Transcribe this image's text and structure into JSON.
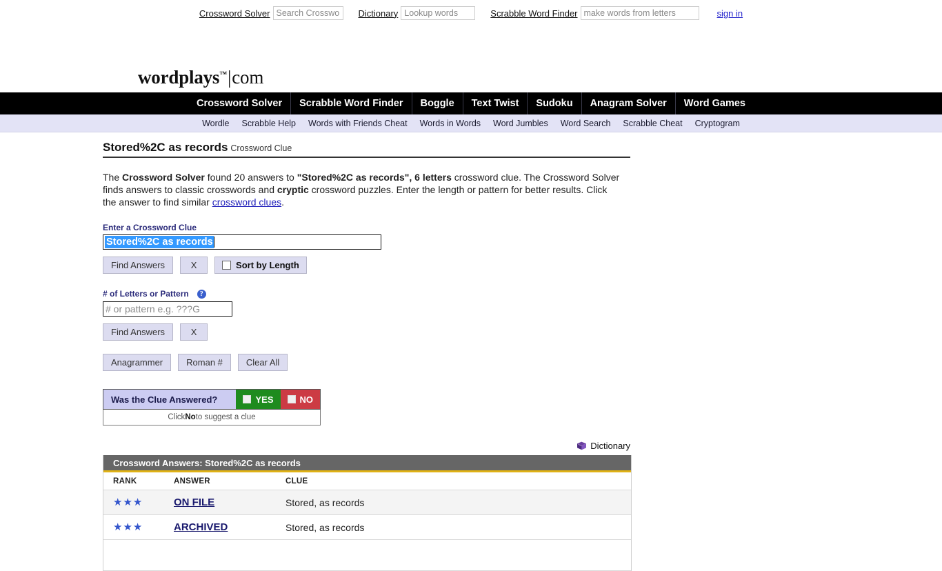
{
  "topbar": {
    "crossword_solver_link": "Crossword Solver",
    "crossword_search_placeholder": "Search Crosswords",
    "dictionary_link": "Dictionary",
    "dictionary_search_placeholder": "Lookup words",
    "scrabble_link": "Scrabble Word Finder",
    "scrabble_search_placeholder": "make words from letters",
    "signin_label": "sign in"
  },
  "logo": {
    "name": "wordplays",
    "tm": "™",
    "separator": "|",
    "domain": "com"
  },
  "mainnav": {
    "items": [
      {
        "label": "Crossword Solver"
      },
      {
        "label": "Scrabble Word Finder"
      },
      {
        "label": "Boggle"
      },
      {
        "label": "Text Twist"
      },
      {
        "label": "Sudoku"
      },
      {
        "label": "Anagram Solver"
      },
      {
        "label": "Word Games"
      }
    ]
  },
  "subnav": {
    "items": [
      {
        "label": "Wordle"
      },
      {
        "label": "Scrabble Help"
      },
      {
        "label": "Words with Friends Cheat"
      },
      {
        "label": "Words in Words"
      },
      {
        "label": "Word Jumbles"
      },
      {
        "label": "Word Search"
      },
      {
        "label": "Scrabble Cheat"
      },
      {
        "label": "Cryptogram"
      }
    ]
  },
  "page": {
    "title": "Stored%2C as records",
    "subtitle": "Crossword Clue",
    "intro": {
      "p1": "The ",
      "b1": "Crossword Solver",
      "p2": " found 20 answers to ",
      "b2": "\"Stored%2C as records\", 6 letters",
      "p3": " crossword clue. The Crossword Solver finds answers to classic crosswords and ",
      "b3": "cryptic",
      "p4": " crossword puzzles. Enter the length or pattern for better results. Click the answer to find similar ",
      "link": "crossword clues",
      "p5": "."
    }
  },
  "form": {
    "clue_label": "Enter a Crossword Clue",
    "clue_value": "Stored%2C as records",
    "find_answers_label": "Find Answers",
    "clear_label": "X",
    "sort_by_length_label": "Sort by Length",
    "pattern_label": "# of Letters or Pattern",
    "help_icon_label": "?",
    "pattern_placeholder": "# or pattern e.g. ???G",
    "find_answers_label2": "Find Answers",
    "clear_label2": "X",
    "anagrammer_label": "Anagrammer",
    "roman_label": "Roman #",
    "clear_all_label": "Clear All"
  },
  "answered": {
    "question": "Was the Clue Answered?",
    "yes_label": "YES",
    "no_label": "NO",
    "note_pre": "Click ",
    "note_bold": "No",
    "note_post": " to suggest a clue",
    "yes_color": "#1e8b1e",
    "no_color": "#cc3b44"
  },
  "dictionary": {
    "label": "Dictionary"
  },
  "results": {
    "title": "Crossword Answers: Stored%2C as records",
    "columns": {
      "rank": "RANK",
      "answer": "ANSWER",
      "clue": "CLUE"
    },
    "rows": [
      {
        "stars": "★★★",
        "answer": "ON FILE",
        "clue": "Stored, as records"
      },
      {
        "stars": "★★★",
        "answer": "ARCHIVED",
        "clue": "Stored, as records"
      }
    ],
    "accent_color": "#e0b215",
    "header_bg": "#666666"
  }
}
